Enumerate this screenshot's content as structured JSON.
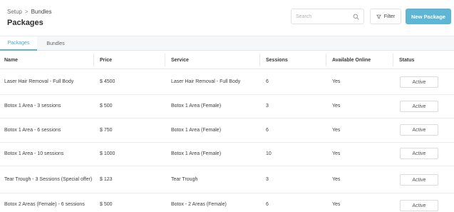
{
  "breadcrumb": {
    "parent": "Setup",
    "separator": ">",
    "current": "Bundles"
  },
  "page_title": "Packages",
  "search": {
    "placeholder": "Search",
    "value": ""
  },
  "toolbar": {
    "filter_label": "Filter",
    "new_label": "New Package"
  },
  "tabs": [
    {
      "label": "Packages",
      "active": true
    },
    {
      "label": "Bundles",
      "active": false
    }
  ],
  "columns": [
    "Name",
    "Price",
    "Service",
    "Sessions",
    "Available Online",
    "Status"
  ],
  "rows": [
    {
      "name": "Laser Hair Removal - Full Body",
      "price": "$ 4500",
      "service": "Laser Hair Removal - Full Body",
      "sessions": "6",
      "online": "Yes",
      "status": "Active"
    },
    {
      "name": "Botox 1 Area - 3 sessions",
      "price": "$ 500",
      "service": "Botox 1 Area (Female)",
      "sessions": "3",
      "online": "Yes",
      "status": "Active"
    },
    {
      "name": "Botox 1 Area - 6 sessions",
      "price": "$ 750",
      "service": "Botox 1 Area (Female)",
      "sessions": "6",
      "online": "Yes",
      "status": "Active"
    },
    {
      "name": "Botox 1 Area - 10 sessions",
      "price": "$ 1000",
      "service": "Botox 1 Area (Female)",
      "sessions": "10",
      "online": "Yes",
      "status": "Active"
    },
    {
      "name": "Tear Trough - 3 Sessions (Special offer)",
      "price": "$ 123",
      "service": "Tear Trough",
      "sessions": "3",
      "online": "Yes",
      "status": "Active"
    },
    {
      "name": "Botox 2 Areas (Female) - 6 sessions",
      "price": "$ 500",
      "service": "Botox - 2 Areas (Female)",
      "sessions": "6",
      "online": "Yes",
      "status": "Active"
    }
  ],
  "colors": {
    "accent": "#5eb6d4",
    "tab_active_text": "#4aa7c7"
  },
  "icons": {
    "search": "search-icon",
    "filter": "filter-icon"
  }
}
